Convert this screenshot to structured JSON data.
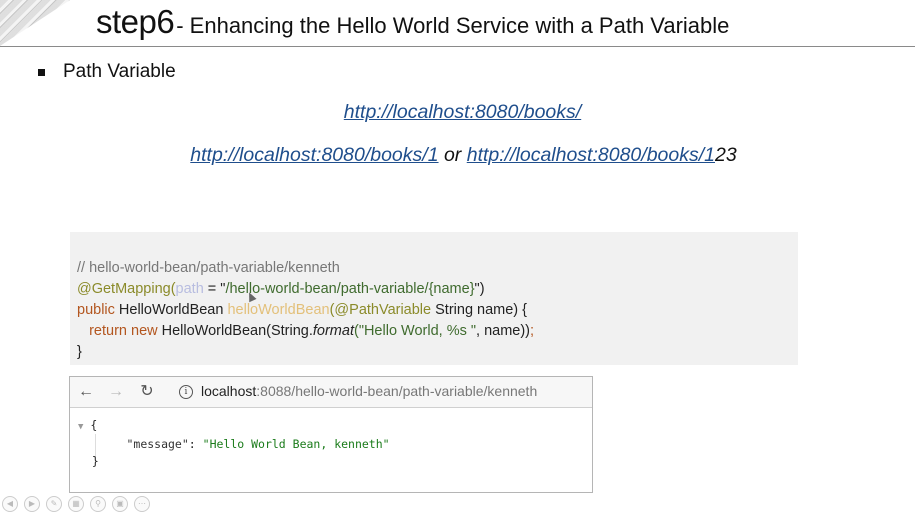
{
  "title": {
    "step": "step6",
    "rest": "- Enhancing the Hello World Service with a Path Variable"
  },
  "bullet": "Path Variable",
  "links": {
    "line1": "http://localhost:8080/books/",
    "line2_a": "http://localhost:8080/books/1",
    "line2_or": " or ",
    "line2_b_link": "http://localhost:8080/books/1",
    "line2_b_rest": "23"
  },
  "code": {
    "comment": "// hello-world-bean/path-variable/kenneth",
    "l2_anno": "@GetMapping(",
    "l2_param": "path",
    "l2_eq": " = \"",
    "l2_str": "/hello-world-bean/path-variable/{name}",
    "l2_end": "\")",
    "l3_kw": "public ",
    "l3_type": "HelloWorldBean ",
    "l3_meth": "helloWorldBean",
    "l3_open": "(",
    "l3_anno": "@PathVariable ",
    "l3_rest": "String name) {",
    "l4_indent": "   ",
    "l4_kw": "return new ",
    "l4_cls": "HelloWorldBean(String.",
    "l4_fmt": "format",
    "l4_str": "(\"Hello World, %s \"",
    "l4_rest": ", name))",
    "l4_semi": ";",
    "l5": "}"
  },
  "browser": {
    "url_host": "localhost",
    "url_path": ":8088/hello-world-bean/path-variable/kenneth",
    "json_open": "{",
    "json_key": "\"message\"",
    "json_colon": ": ",
    "json_value": "\"Hello World Bean, kenneth\"",
    "json_close": "}"
  },
  "icons": {
    "back": "back-arrow-icon",
    "forward": "forward-arrow-icon",
    "reload": "reload-icon",
    "info": "info-icon"
  }
}
